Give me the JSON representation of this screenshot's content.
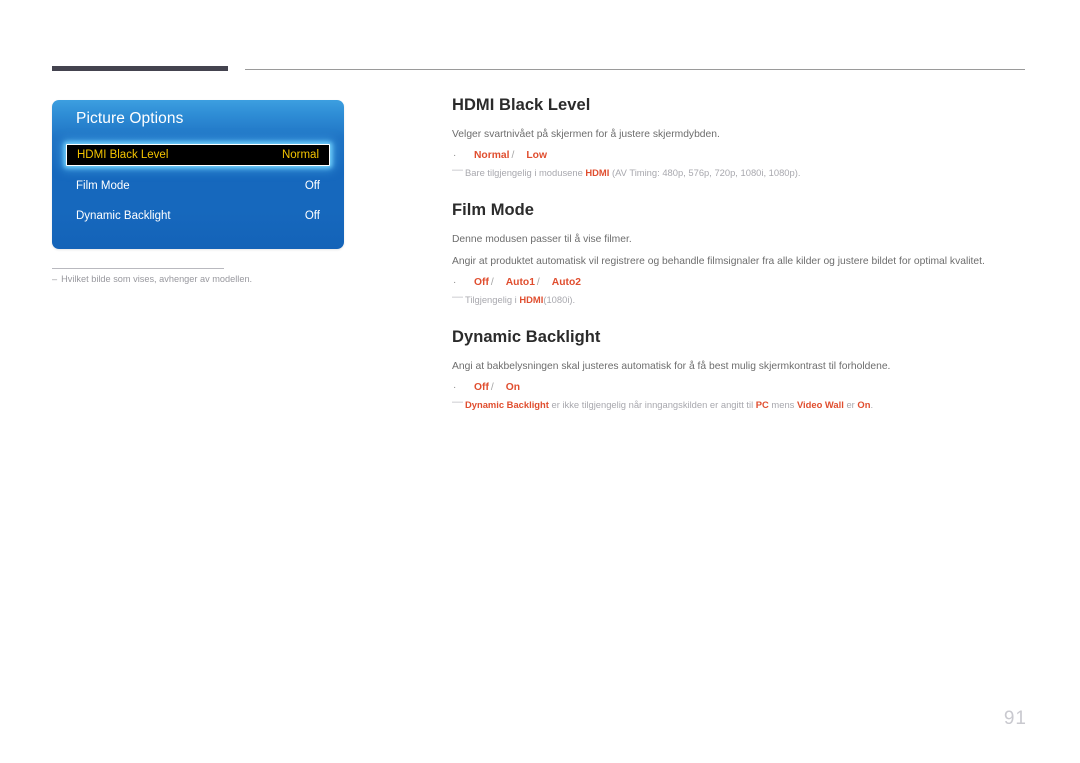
{
  "page": {
    "number": "91"
  },
  "osd": {
    "title": "Picture Options",
    "rows": [
      {
        "label": "HDMI Black Level",
        "value": "Normal",
        "selected": true
      },
      {
        "label": "Film Mode",
        "value": "Off",
        "selected": false
      },
      {
        "label": "Dynamic Backlight",
        "value": "Off",
        "selected": false
      }
    ],
    "footnote": {
      "dash": "–",
      "text": "Hvilket bilde som vises, avhenger av modellen."
    }
  },
  "sections": [
    {
      "heading": "HDMI Black Level",
      "paragraphs": [
        "Velger svartnivået på skjermen for å justere skjermdybden."
      ],
      "options": {
        "bullet": "·",
        "items": [
          "Normal",
          "Low"
        ],
        "separator": "/"
      },
      "note": {
        "dash": "—",
        "parts": [
          {
            "text": "Bare tilgjengelig i modusene ",
            "highlight": false
          },
          {
            "text": "HDMI",
            "highlight": true
          },
          {
            "text": " (AV Timing: 480p, 576p, 720p, 1080i, 1080p).",
            "highlight": false
          }
        ]
      }
    },
    {
      "heading": "Film Mode",
      "paragraphs": [
        "Denne modusen passer til å vise filmer.",
        "Angir at produktet automatisk vil registrere og behandle filmsignaler fra alle kilder og justere bildet for optimal kvalitet."
      ],
      "options": {
        "bullet": "·",
        "items": [
          "Off",
          "Auto1",
          "Auto2"
        ],
        "separator": "/"
      },
      "note": {
        "dash": "—",
        "parts": [
          {
            "text": "Tilgjengelig i ",
            "highlight": false
          },
          {
            "text": "HDMI",
            "highlight": true
          },
          {
            "text": "(1080i).",
            "highlight": false
          }
        ]
      }
    },
    {
      "heading": "Dynamic Backlight",
      "paragraphs": [
        "Angi at bakbelysningen skal justeres automatisk for å få best mulig skjermkontrast til forholdene."
      ],
      "options": {
        "bullet": "·",
        "items": [
          "Off",
          "On"
        ],
        "separator": "/"
      },
      "note": {
        "dash": "—",
        "parts": [
          {
            "text": "Dynamic Backlight",
            "highlight": true
          },
          {
            "text": " er ikke tilgjengelig når inngangskilden er angitt til ",
            "highlight": false
          },
          {
            "text": "PC",
            "highlight": true
          },
          {
            "text": " mens ",
            "highlight": false
          },
          {
            "text": "Video Wall",
            "highlight": true
          },
          {
            "text": " er ",
            "highlight": false
          },
          {
            "text": "On",
            "highlight": true
          },
          {
            "text": ".",
            "highlight": false
          }
        ]
      }
    }
  ],
  "colors": {
    "accent_red": "#e04e2f",
    "osd_blue": "#1668bd",
    "osd_selected_text": "#f3c300",
    "heading": "#2b2b2b",
    "body": "#6d6d6d",
    "note": "#a8a8ae",
    "rule_dark": "#44434f"
  }
}
